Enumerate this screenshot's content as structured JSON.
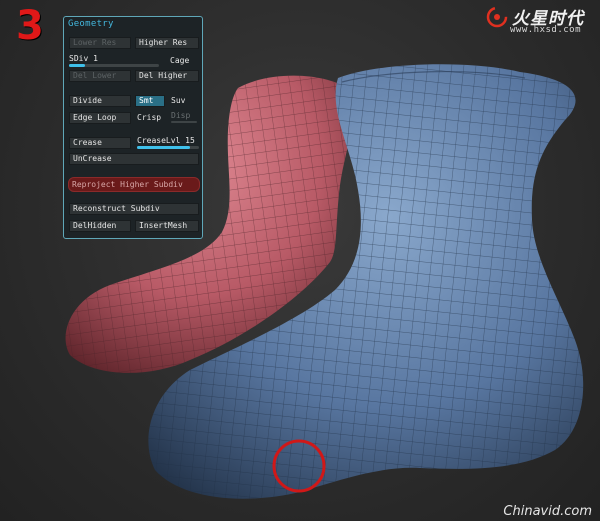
{
  "step_number": "3",
  "brand": {
    "logo_text": "火星时代",
    "url_text": "www.hxsd.com",
    "accent_color": "#e03020"
  },
  "watermark": "Chinavid.com",
  "panel": {
    "title": "Geometry",
    "lower_res": "Lower Res",
    "higher_res": "Higher Res",
    "sdiv_label": "SDiv 1",
    "sdiv_level": 0.18,
    "cage": "Cage",
    "del_lower": "Del Lower",
    "del_higher": "Del Higher",
    "divide": "Divide",
    "smt": "Smt",
    "suv": "Suv",
    "edge_loop": "Edge Loop",
    "crisp": "Crisp",
    "disp": "Disp",
    "crease": "Crease",
    "crease_lvl_label": "CreaseLvl 15",
    "crease_lvl_level": 0.85,
    "uncrease": "UnCrease",
    "reproject": "Reproject Higher Subdiv",
    "reconstruct": "Reconstruct Subdiv",
    "del_hidden": "DelHidden",
    "insert_mesh": "InsertMesh"
  },
  "colors": {
    "panel_accent": "#43b6dc",
    "pink_mesh": "#c06470",
    "blue_mesh": "#5c7ea6",
    "highlight_circle": "#d01818",
    "step_number": "#e01818"
  }
}
